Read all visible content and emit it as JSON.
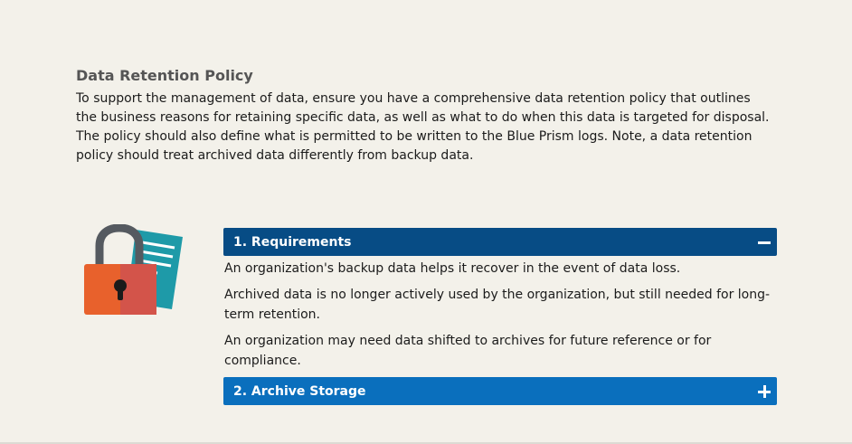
{
  "intro": {
    "title": "Data Retention Policy",
    "body": "To support the management of data, ensure you have a comprehensive data retention policy that outlines the business reasons for retaining specific data, as well as what to do when this data is targeted for disposal. The policy should also define what is permitted to be written to the Blue Prism logs. Note, a data retention policy should treat archived data differently from backup data."
  },
  "illustration": {
    "icons": [
      "padlock-icon",
      "document-icon"
    ]
  },
  "accordion": {
    "sections": [
      {
        "title": "1. Requirements",
        "state": "expanded",
        "toggle_icon": "minus-icon",
        "paragraphs": [
          "An organization's backup data helps it recover in the event of data loss.",
          "Archived data is no longer actively used by the organization, but still needed for long-term retention.",
          "An organization may need data shifted to archives for future reference or for compliance."
        ]
      },
      {
        "title": "2. Archive Storage",
        "state": "collapsed",
        "toggle_icon": "plus-icon"
      }
    ]
  },
  "colors": {
    "background": "#f3f1ea",
    "header_expanded": "#074c85",
    "header_collapsed": "#0a6fbd",
    "lock_orange": "#e8612c",
    "document_teal": "#1e9aa8"
  }
}
